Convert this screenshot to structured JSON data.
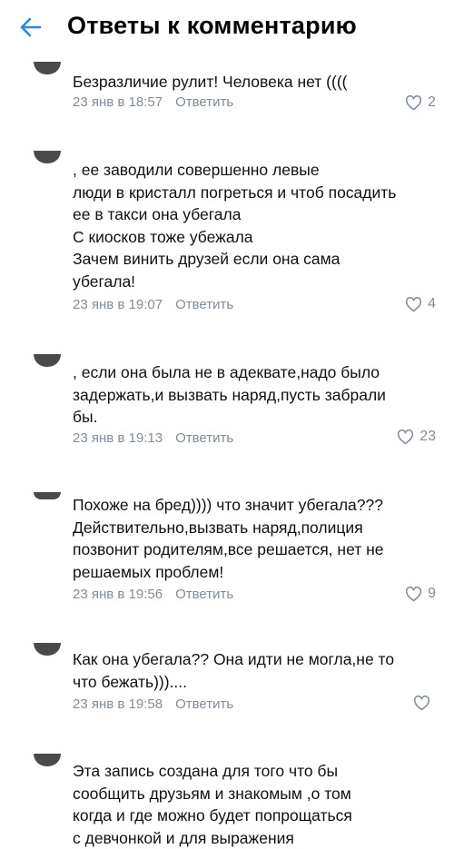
{
  "header": {
    "title": "Ответы к комментарию"
  },
  "colors": {
    "accent": "#2688eb",
    "secondary": "#818c99"
  },
  "comments": [
    {
      "text": "Безразличие рулит! Человека нет ((((",
      "time": "23 янв в 18:57",
      "reply": "Ответить",
      "likes": "2"
    },
    {
      "text": "          , ее заводили совершенно левые\nлюди в кристалл погреться и чтоб посадить\nее в такси она убегала\nС киосков тоже убежала\nЗачем винить друзей если она сама\nубегала!",
      "time": "23 янв в 19:07",
      "reply": "Ответить",
      "likes": "4"
    },
    {
      "text": "    , если она была не в адеквате,надо было\nзадержать,и вызвать наряд,пусть забрали\nбы.",
      "time": "23 янв в 19:13",
      "reply": "Ответить",
      "likes": "23"
    },
    {
      "text": "Похоже на бред)))) что значит убегала???\nДействительно,вызвать наряд,полиция\nпозвонит родителям,все решается, нет не\nрешаемых проблем!",
      "time": "23 янв в 19:56",
      "reply": "Ответить",
      "likes": "9"
    },
    {
      "text": "Как она убегала?? Она идти не могла,не то\nчто бежать)))....",
      "time": "23 янв в 19:58",
      "reply": "Ответить",
      "likes": ""
    },
    {
      "text": "Эта запись создана для того что бы\nсообщить друзьям и знакомым ,о том\nкогда и где можно будет попрощаться\nс девчонкой и для выражения",
      "time": "",
      "reply": "",
      "likes": ""
    }
  ]
}
